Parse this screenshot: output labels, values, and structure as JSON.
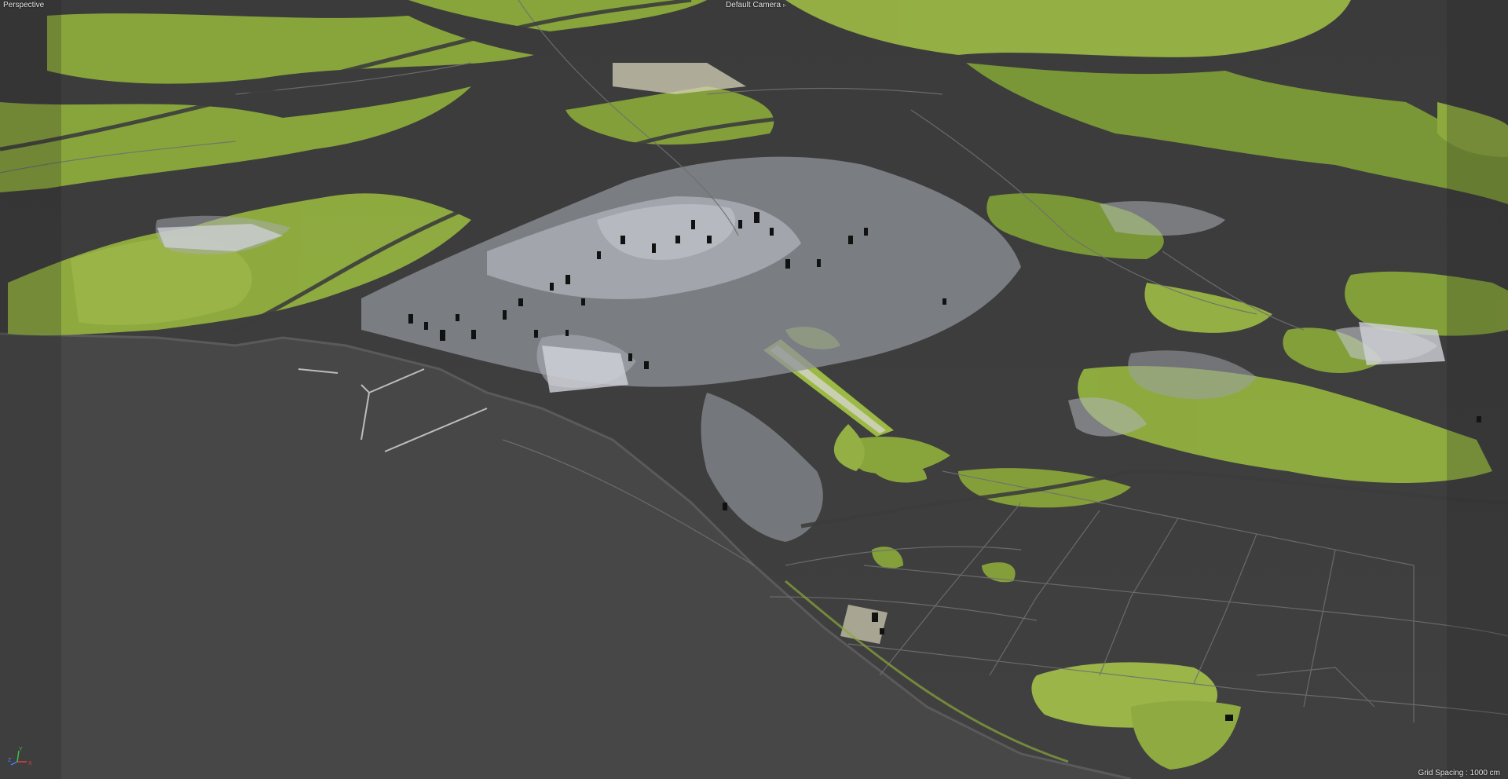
{
  "viewport": {
    "view_label": "Perspective",
    "camera_label": "Default Camera",
    "camera_icon": "camera-icon",
    "grid_spacing": "Grid Spacing : 1000 cm",
    "axis_labels": {
      "x": "X",
      "y": "Y",
      "z": "Z"
    }
  },
  "colors": {
    "background": "#4a4a4a",
    "sea": "#474747",
    "land": "#3f3f3f",
    "vegetation": "#8aa83a",
    "vegetation_light": "#a9c24a",
    "vegetation_dark": "#5f7f2a",
    "urban": "#c6cad1",
    "roads": "#6e6e6e",
    "axis_x": "#e04040",
    "axis_y": "#40c040",
    "axis_z": "#4080ff"
  }
}
